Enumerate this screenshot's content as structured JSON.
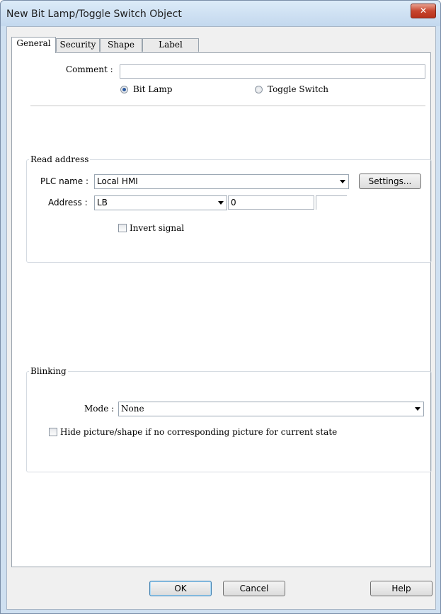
{
  "window": {
    "title": "New Bit Lamp/Toggle Switch Object",
    "close_label": "✕"
  },
  "tabs": [
    {
      "label": "General",
      "active": true
    },
    {
      "label": "Security",
      "active": false
    },
    {
      "label": "Shape",
      "active": false
    },
    {
      "label": "Label",
      "active": false
    }
  ],
  "general": {
    "comment_label": "Comment :",
    "comment_value": "",
    "type_options": [
      {
        "label": "Bit Lamp",
        "selected": true
      },
      {
        "label": "Toggle Switch",
        "selected": false
      }
    ]
  },
  "read_address": {
    "group_title": "Read address",
    "plc_name_label": "PLC name :",
    "plc_name_value": "Local HMI",
    "settings_button": "Settings...",
    "address_label": "Address :",
    "address_type_value": "LB",
    "address_value": "0",
    "extra_value": "",
    "invert_signal_label": "Invert signal",
    "invert_signal_checked": false
  },
  "blinking": {
    "group_title": "Blinking",
    "mode_label": "Mode :",
    "mode_value": "None",
    "hide_picture_label": "Hide picture/shape if no corresponding picture for current state",
    "hide_picture_checked": false
  },
  "footer": {
    "ok_button": "OK",
    "cancel_button": "Cancel",
    "help_button": "Help"
  }
}
